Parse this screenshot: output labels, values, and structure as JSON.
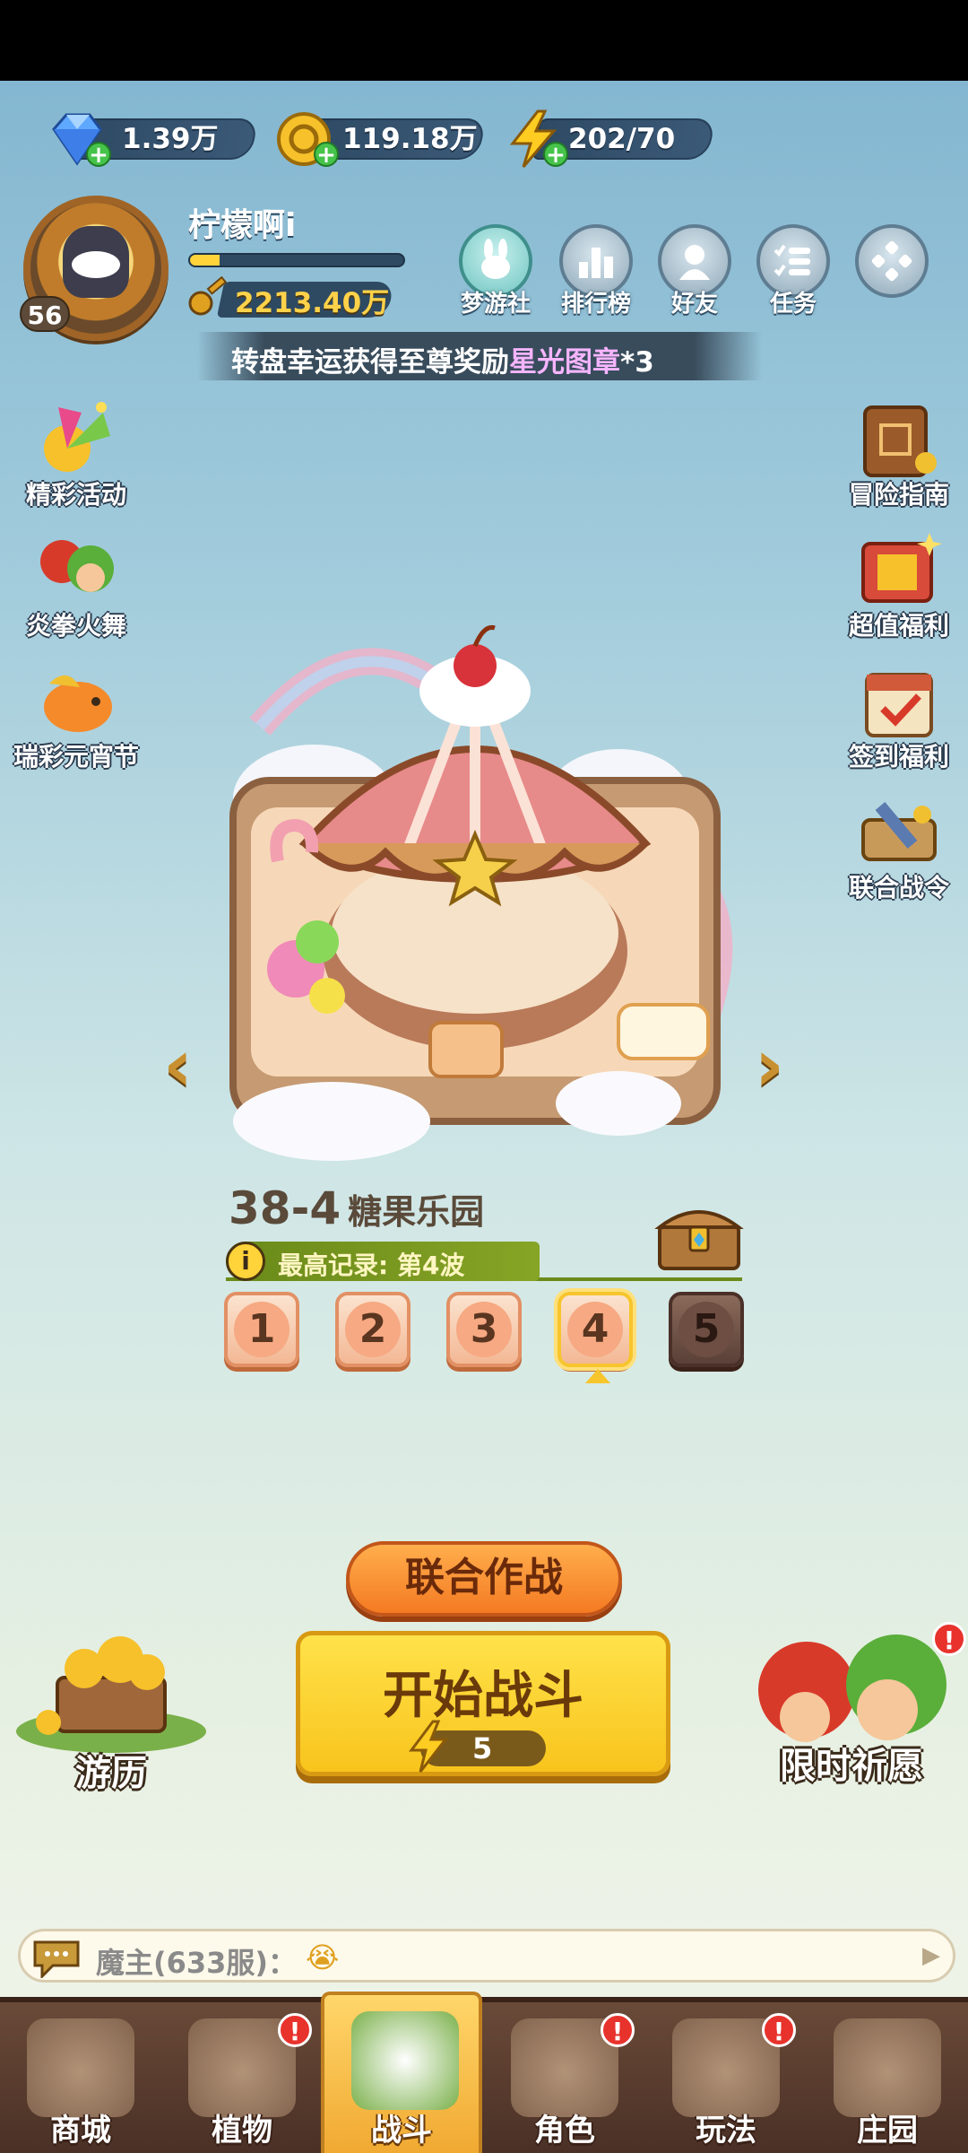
{
  "currency": {
    "gems": "1.39万",
    "coins": "119.18万",
    "energy": "202/70"
  },
  "player": {
    "name": "柠檬啊i",
    "level": "56",
    "gold": "2213.40万",
    "exp_fraction": 0.14
  },
  "top_menu": [
    {
      "label": "梦游社",
      "icon": "bunny-icon"
    },
    {
      "label": "排行榜",
      "icon": "bar-chart-icon"
    },
    {
      "label": "好友",
      "icon": "friend-icon"
    },
    {
      "label": "任务",
      "icon": "task-list-icon"
    },
    {
      "label": "",
      "icon": "more-icon"
    }
  ],
  "marquee": {
    "prefix": "转盘幸运获得至尊奖励",
    "highlight": "星光图章",
    "suffix": "*3"
  },
  "left_side": [
    {
      "label": "精彩活动"
    },
    {
      "label": "炎拳火舞"
    },
    {
      "label": "瑞彩元宵节"
    }
  ],
  "right_side": [
    {
      "label": "冒险指南"
    },
    {
      "label": "超值福利"
    },
    {
      "label": "签到福利"
    },
    {
      "label": "联合战令"
    }
  ],
  "stage": {
    "number": "38-4",
    "name": "糖果乐园",
    "record": "最高记录: 第4波",
    "prev_arrow": "‹",
    "next_arrow": "›",
    "waves": [
      "1",
      "2",
      "3",
      "4",
      "5"
    ],
    "selected_wave": "4"
  },
  "actions": {
    "coop": "联合作战",
    "start": "开始战斗",
    "energy_cost": "5"
  },
  "bottom_left": {
    "label": "游历"
  },
  "bottom_right": {
    "label": "限时祈愿",
    "badge": "!"
  },
  "chat": {
    "text": "魔主(633服)：",
    "emoji": "😭",
    "arrow": "▶"
  },
  "nav": [
    {
      "label": "商城",
      "badge": ""
    },
    {
      "label": "植物",
      "badge": "!"
    },
    {
      "label": "战斗",
      "badge": ""
    },
    {
      "label": "角色",
      "badge": "!"
    },
    {
      "label": "玩法",
      "badge": "!"
    },
    {
      "label": "庄园",
      "badge": ""
    }
  ],
  "colors": {
    "accent_yellow": "#ffd33a",
    "record_green": "#86a425",
    "alert_red": "#e8322c"
  }
}
